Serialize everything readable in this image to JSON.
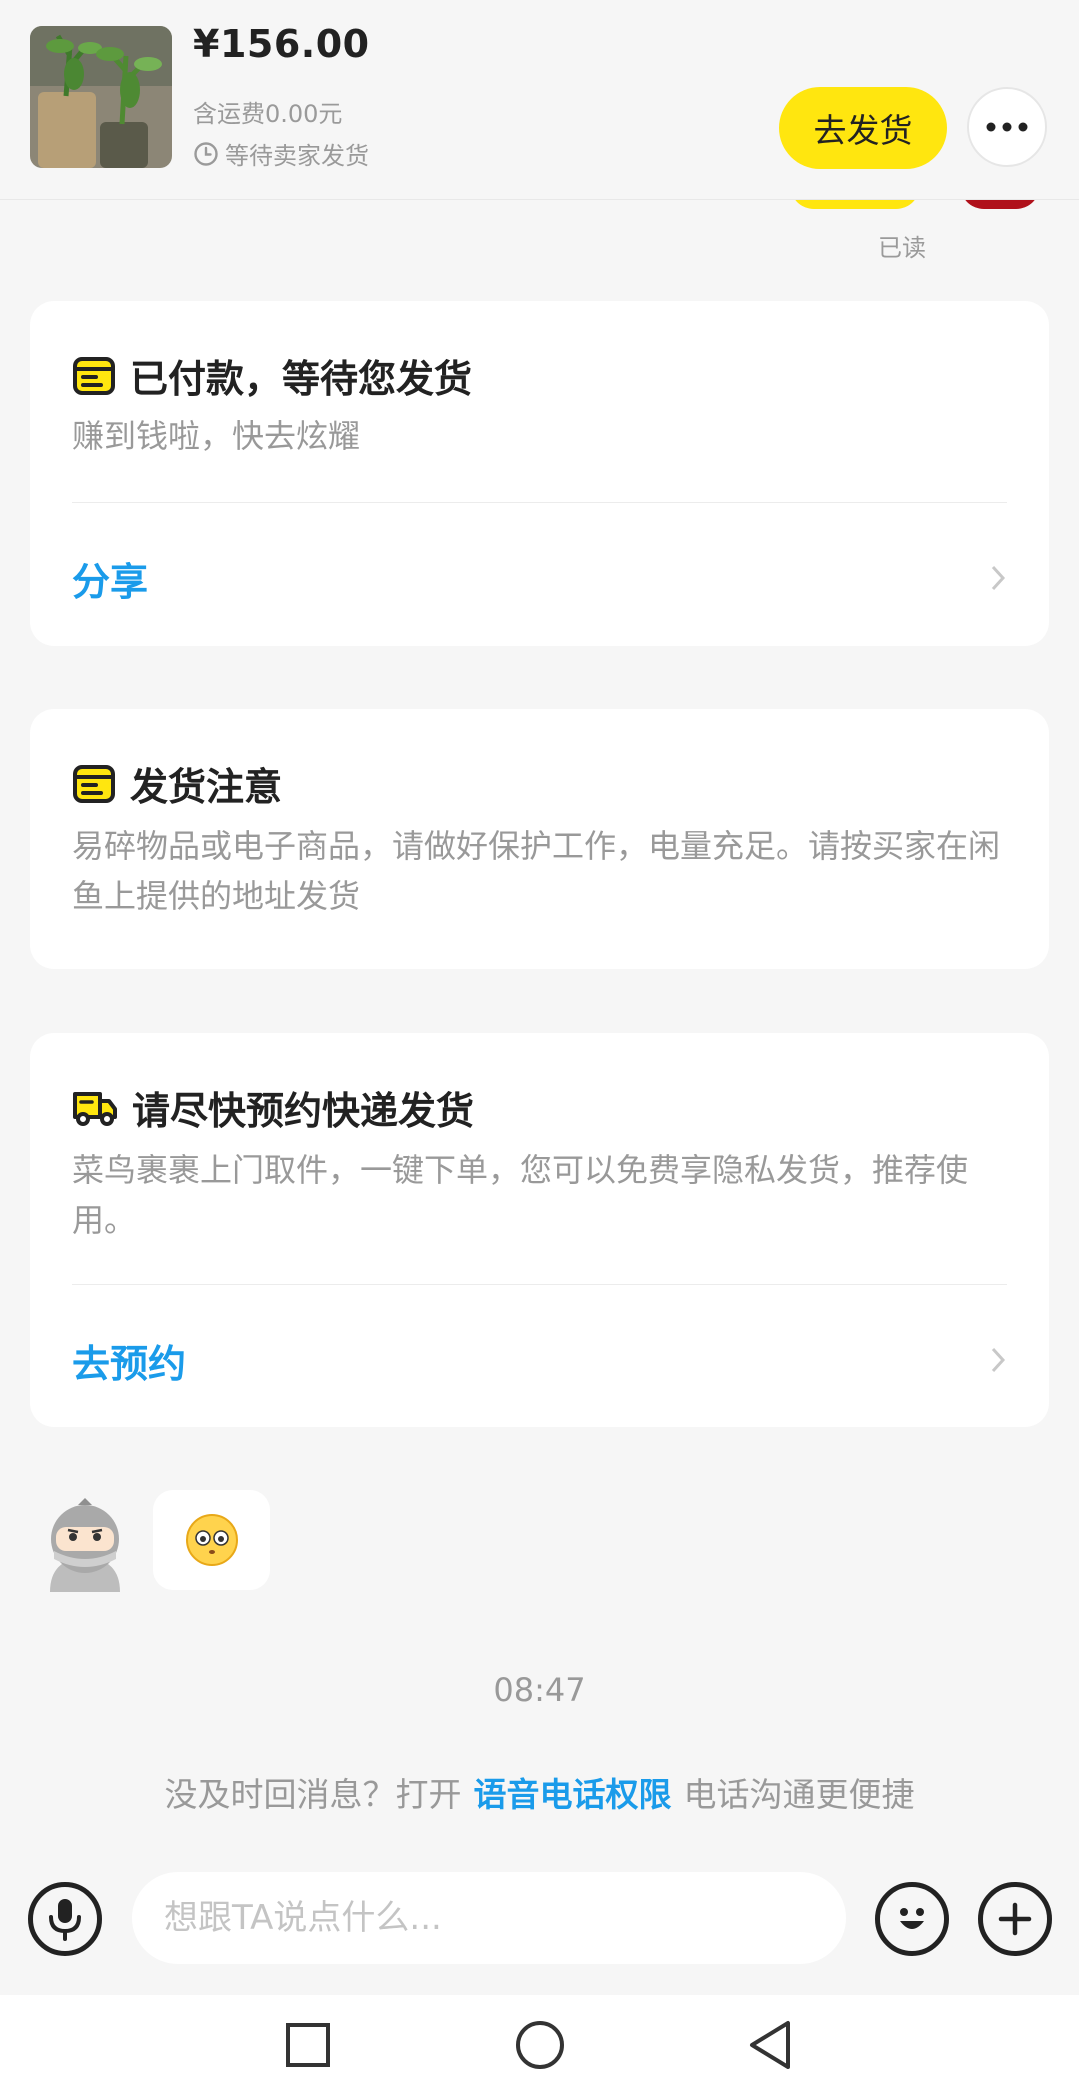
{
  "product": {
    "price": "¥156.00",
    "shipping": "含运费0.00元",
    "status": "等待卖家发货",
    "image_icon": "plant-thumbnail-image",
    "ship_button": "去发货",
    "more_icon": "more-dots-icon"
  },
  "prev_message": {
    "read_label": "已读"
  },
  "card_paid": {
    "icon": "order-card-icon",
    "title": "已付款，等待您发货",
    "desc": "赚到钱啦，快去炫耀",
    "link": "分享"
  },
  "card_notice": {
    "icon": "order-card-icon",
    "title": "发货注意",
    "desc": "易碎物品或电子商品，请做好保护工作，电量充足。请按买家在闲鱼上提供的地址发货"
  },
  "card_courier": {
    "icon": "delivery-truck-icon",
    "title": "请尽快预约快递发货",
    "desc": "菜鸟裹裹上门取件，一键下单，您可以免费享隐私发货，推荐使用。",
    "link": "去预约"
  },
  "chat": {
    "avatar_icon": "ninja-avatar",
    "emoji_icon": "neutral-face-emoji",
    "timestamp": "08:47",
    "tip_prefix": "没及时回消息？打开",
    "tip_link": "语音电话权限",
    "tip_suffix": "电话沟通更便捷"
  },
  "input": {
    "placeholder": "想跟TA说点什么...",
    "mic_icon": "microphone-icon",
    "emoji_icon": "smiley-icon",
    "plus_icon": "plus-icon"
  },
  "nav": {
    "recents_icon": "square-icon",
    "home_icon": "circle-icon",
    "back_icon": "triangle-back-icon"
  },
  "colors": {
    "brand_yellow": "#ffe60f",
    "link_blue": "#1a9bea",
    "background": "#f6f6f6"
  }
}
